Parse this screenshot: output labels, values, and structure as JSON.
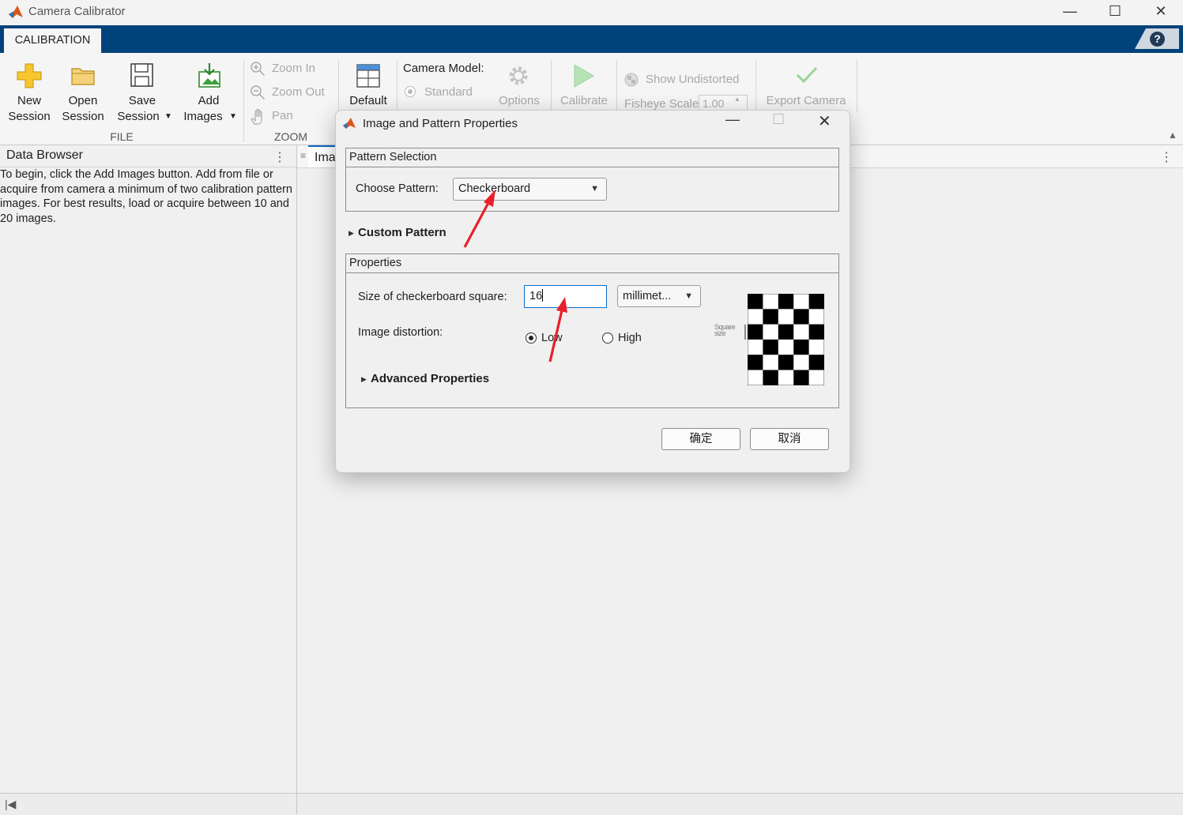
{
  "window": {
    "title": "Camera Calibrator",
    "buttons": [
      "—",
      "☐",
      "✕"
    ]
  },
  "ribbon": {
    "tab": "CALIBRATION",
    "help": "?",
    "file": {
      "new_line1": "New",
      "new_line2": "Session",
      "open_line1": "Open",
      "open_line2": "Session",
      "save_line1": "Save",
      "save_line2": "Session",
      "add_line1": "Add",
      "add_line2": "Images",
      "section": "FILE"
    },
    "zoom": {
      "zoom_in": "Zoom In",
      "zoom_out": "Zoom Out",
      "pan": "Pan",
      "section": "ZOOM"
    },
    "layout": {
      "default": "Default"
    },
    "camera_model": {
      "label": "Camera Model:",
      "standard": "Standard",
      "options": "Options"
    },
    "calibrate": "Calibrate",
    "show_undistorted": "Show Undistorted",
    "fisheye_scale_label": "Fisheye Scale",
    "fisheye_scale_value": "1.00",
    "export": "Export Camera"
  },
  "data_browser": {
    "title": "Data Browser",
    "message": "To begin, click the Add Images button. Add from file or acquire from camera a minimum of two calibration pattern images. For best results, load or acquire between 10 and 20 images."
  },
  "main": {
    "tab_label": "Ima"
  },
  "dialog": {
    "title": "Image and Pattern Properties",
    "pattern_selection": {
      "title": "Pattern Selection",
      "choose_label": "Choose Pattern:",
      "choose_value": "Checkerboard"
    },
    "custom_pattern": "Custom Pattern",
    "properties": {
      "title": "Properties",
      "size_label": "Size of checkerboard square:",
      "size_value": "16",
      "unit_value": "millimet...",
      "distortion_label": "Image distortion:",
      "low": "Low",
      "high": "High",
      "low_selected": true,
      "advanced": "Advanced Properties",
      "preview_label_1": "Square",
      "preview_label_2": "size"
    },
    "ok": "确定",
    "cancel": "取消"
  },
  "colors": {
    "ribbon_blue": "#00437a",
    "annotation_red": "#e8202a"
  }
}
